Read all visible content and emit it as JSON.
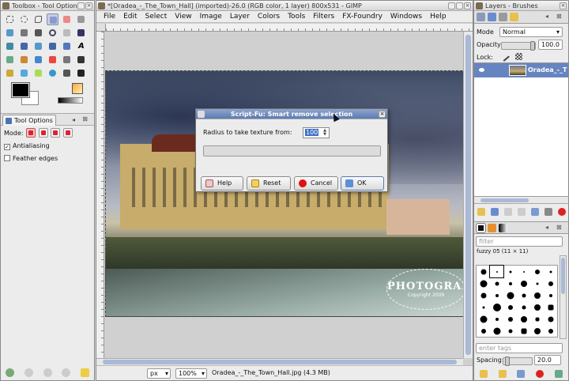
{
  "toolbox": {
    "title": "Toolbox - Tool Options",
    "tool_options_tab": "Tool Options",
    "mode_label": "Mode:",
    "antialiasing_label": "Antialiasing",
    "antialiasing_checked": "✓",
    "feather_label": "Feather edges"
  },
  "image_window": {
    "title": "*[Oradea_-_The_Town_Hall] (imported)-26.0 (RGB color, 1 layer) 800x531 - GIMP",
    "menu": [
      "File",
      "Edit",
      "Select",
      "View",
      "Image",
      "Layer",
      "Colors",
      "Tools",
      "Filters",
      "FX-Foundry",
      "Windows",
      "Help"
    ],
    "status": {
      "unit": "px",
      "zoom": "100%",
      "file_info": "Oradea_-_The_Town_Hall.jpg (4.3 MB)"
    },
    "watermark": {
      "line1": "PHOTOGRAPHY",
      "line2": "Copyright 2009"
    }
  },
  "dialog": {
    "title": "Script-Fu: Smart remove selection",
    "radius_label": "Radius to take texture from:",
    "radius_value": "100",
    "progress": 0,
    "buttons": {
      "help": "Help",
      "reset": "Reset",
      "cancel": "Cancel",
      "ok": "OK"
    }
  },
  "dock": {
    "title": "Layers - Brushes",
    "mode_label": "Mode",
    "mode_value": "Normal",
    "opacity_label": "Opacity",
    "opacity_value": "100.0",
    "lock_label": "Lock:",
    "layer_name": "Oradea_-_T",
    "filter_placeholder": "filter",
    "brush_name": "fuzzy 05 (11 × 11)",
    "tags_placeholder": "enter tags",
    "spacing_label": "Spacing:",
    "spacing_value": "20.0"
  },
  "colors": {
    "selection_blue": "#6685c0",
    "fg": "#000000",
    "bg": "#ffffff"
  }
}
